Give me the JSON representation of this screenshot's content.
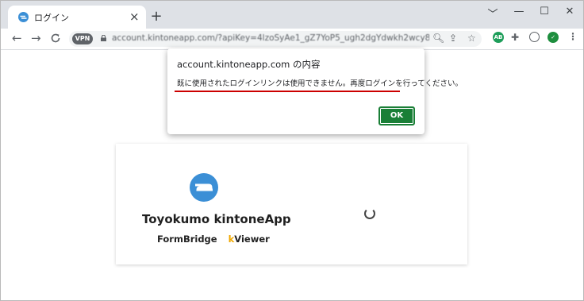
{
  "browser": {
    "tab_title": "ログイン",
    "tab_close": "×",
    "new_tab": "+",
    "url": "account.kintoneapp.com/?apiKey=4lzoSyAe1_gZ7YoP5_ugh2dgYdwkh2wcy8Aqcs8ecoh6o...",
    "vpn_label": "VPN",
    "window_controls": [
      "﹀",
      "—",
      "☐",
      "✕"
    ]
  },
  "dialog": {
    "title": "account.kintoneapp.com の内容",
    "message": "既に使用されたログインリンクは使用できません。再度ログインを行ってください。",
    "ok_label": "OK"
  },
  "app": {
    "name": "Toyokumo kintoneApp",
    "product_1": "FormBridge",
    "product_2_prefix": "k",
    "product_2_rest": "Viewer"
  },
  "colors": {
    "accent_green": "#1a7f37",
    "logo_blue": "#3b8fd6",
    "underline_red": "#cc0000",
    "kviewer_orange": "#f0a800"
  }
}
